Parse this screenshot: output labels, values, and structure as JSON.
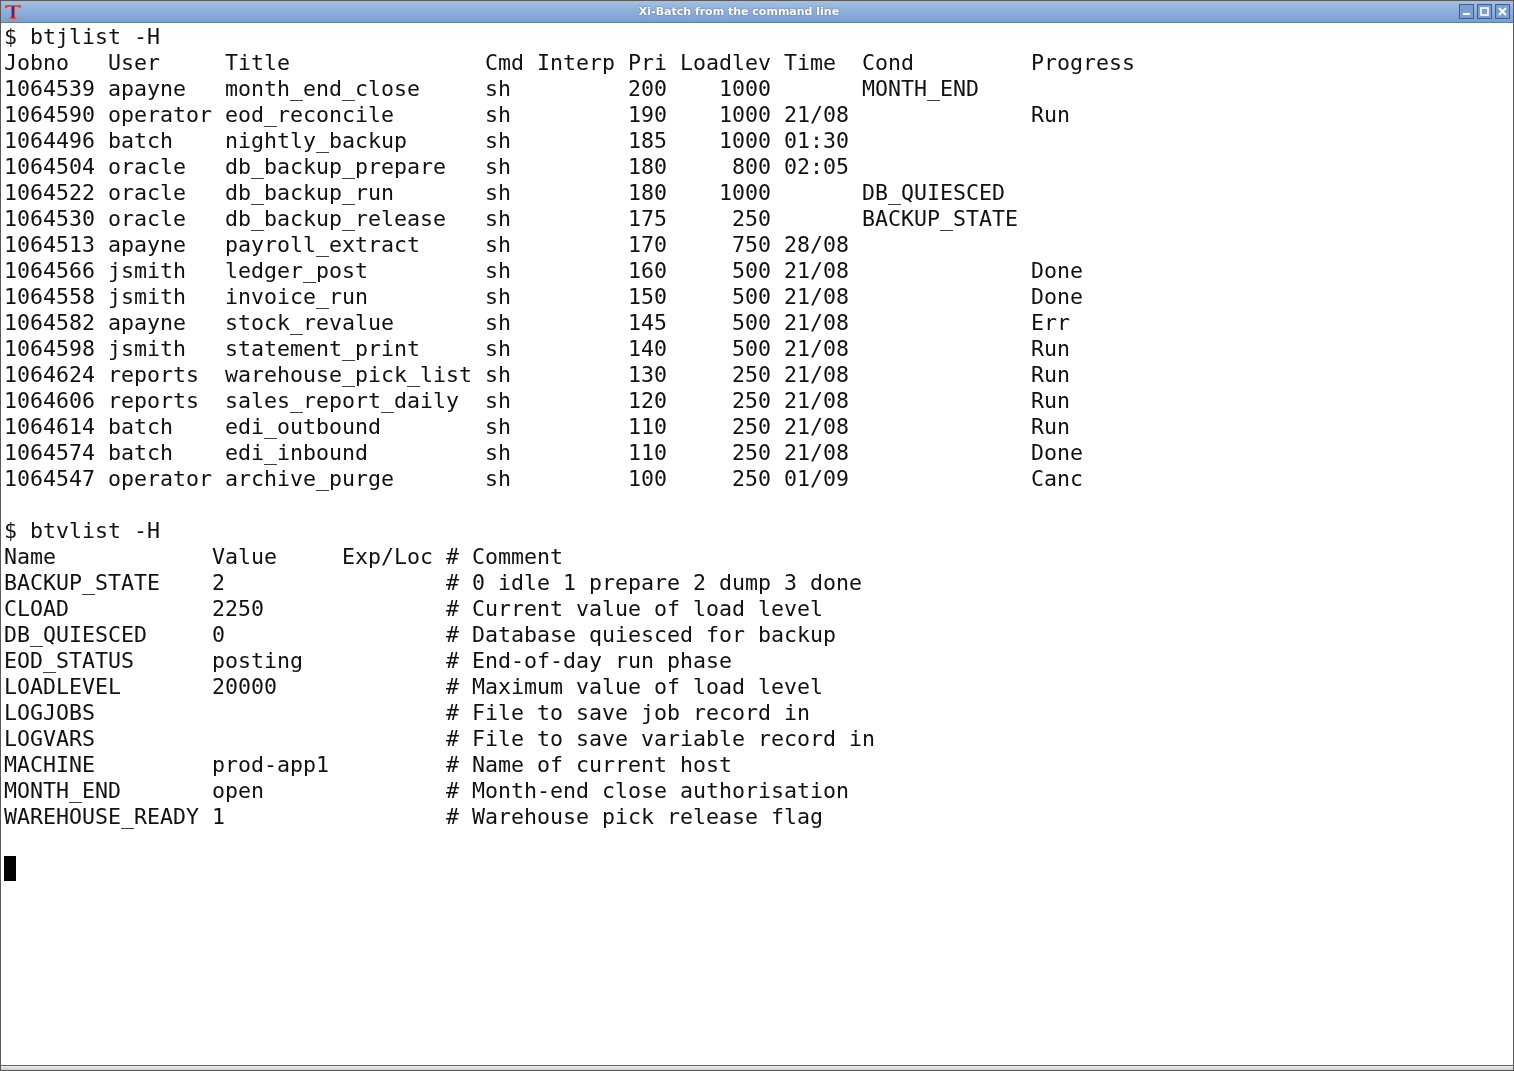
{
  "window": {
    "title": "Xi-Batch from the command line"
  },
  "terminal": {
    "blocks": [
      {
        "prompt": "$",
        "command": "btjlist -H",
        "columns": [
          "Jobno",
          "User",
          "Title",
          "Cmd",
          "Interp",
          "Pri",
          "Loadlev",
          "Time",
          "Cond",
          "Progress"
        ],
        "rows": [
          [
            "1064539",
            "apayne",
            "month_end_close",
            "sh",
            null,
            "200",
            "1000",
            null,
            "MONTH_END",
            null
          ],
          [
            "1064590",
            "operator",
            "eod_reconcile",
            "sh",
            null,
            "190",
            "1000",
            "21/08",
            null,
            "Run"
          ],
          [
            "1064496",
            "batch",
            "nightly_backup",
            "sh",
            null,
            "185",
            "1000",
            "01:30",
            null,
            null
          ],
          [
            "1064504",
            "oracle",
            "db_backup_prepare",
            "sh",
            null,
            "180",
            "800",
            "02:05",
            null,
            null
          ],
          [
            "1064522",
            "oracle",
            "db_backup_run",
            "sh",
            null,
            "180",
            "1000",
            null,
            "DB_QUIESCED",
            null
          ],
          [
            "1064530",
            "oracle",
            "db_backup_release",
            "sh",
            null,
            "175",
            "250",
            null,
            "BACKUP_STATE",
            null
          ],
          [
            "1064513",
            "apayne",
            "payroll_extract",
            "sh",
            null,
            "170",
            "750",
            "28/08",
            null,
            null
          ],
          [
            "1064566",
            "jsmith",
            "ledger_post",
            "sh",
            null,
            "160",
            "500",
            "21/08",
            null,
            "Done"
          ],
          [
            "1064558",
            "jsmith",
            "invoice_run",
            "sh",
            null,
            "150",
            "500",
            "21/08",
            null,
            "Done"
          ],
          [
            "1064582",
            "apayne",
            "stock_revalue",
            "sh",
            null,
            "145",
            "500",
            "21/08",
            null,
            "Err"
          ],
          [
            "1064598",
            "jsmith",
            "statement_print",
            "sh",
            null,
            "140",
            "500",
            "21/08",
            null,
            "Run"
          ],
          [
            "1064624",
            "reports",
            "warehouse_pick_list",
            "sh",
            null,
            "130",
            "250",
            "21/08",
            null,
            "Run"
          ],
          [
            "1064606",
            "reports",
            "sales_report_daily",
            "sh",
            null,
            "120",
            "250",
            "21/08",
            null,
            "Run"
          ],
          [
            "1064614",
            "batch",
            "edi_outbound",
            "sh",
            null,
            "110",
            "250",
            "21/08",
            null,
            "Run"
          ],
          [
            "1064574",
            "batch",
            "edi_inbound",
            "sh",
            null,
            "110",
            "250",
            "21/08",
            null,
            "Done"
          ],
          [
            "1064547",
            "operator",
            "archive_purge",
            "sh",
            null,
            "100",
            "250",
            "01/09",
            null,
            "Canc"
          ]
        ]
      },
      {
        "prompt": "$",
        "command": "btvlist -H",
        "columns": [
          "Name",
          "Value",
          "Exp/Loc",
          "# Comment"
        ],
        "rows": [
          [
            "BACKUP_STATE",
            "2",
            null,
            "# 0 idle 1 prepare 2 dump 3 done"
          ],
          [
            "CLOAD",
            "2250",
            null,
            "# Current value of load level"
          ],
          [
            "DB_QUIESCED",
            "0",
            null,
            "# Database quiesced for backup"
          ],
          [
            "EOD_STATUS",
            "posting",
            null,
            "# End-of-day run phase"
          ],
          [
            "LOADLEVEL",
            "20000",
            null,
            "# Maximum value of load level"
          ],
          [
            "LOGJOBS",
            null,
            null,
            "# File to save job record in"
          ],
          [
            "LOGVARS",
            null,
            null,
            "# File to save variable record in"
          ],
          [
            "MACHINE",
            "prod-app1",
            null,
            "# Name of current host"
          ],
          [
            "MONTH_END",
            "open",
            null,
            "# Month-end close authorisation"
          ],
          [
            "WAREHOUSE_READY",
            "1",
            null,
            "# Warehouse pick release flag"
          ]
        ]
      }
    ]
  }
}
